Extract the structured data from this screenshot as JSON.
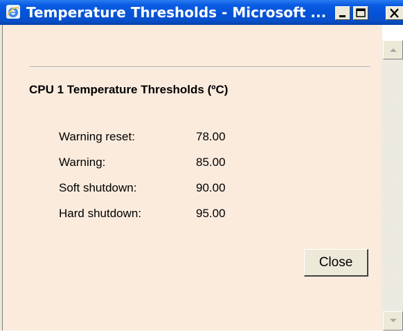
{
  "window": {
    "title": "Temperature Thresholds - Microsoft ...",
    "icons": {
      "app": "internet-explorer-icon",
      "minimize": "minimize-icon",
      "maximize": "maximize-icon",
      "close": "close-icon"
    }
  },
  "panel": {
    "heading": "CPU 1 Temperature Thresholds (ºC)",
    "rows": [
      {
        "label": "Warning reset:",
        "value": "78.00"
      },
      {
        "label": "Warning:",
        "value": "85.00"
      },
      {
        "label": "Soft shutdown:",
        "value": "90.00"
      },
      {
        "label": "Hard shutdown:",
        "value": "95.00"
      }
    ],
    "close_label": "Close"
  },
  "colors": {
    "titlebar": "#0453d8",
    "client_background": "#faebdd",
    "button_face": "#ece9d8"
  }
}
